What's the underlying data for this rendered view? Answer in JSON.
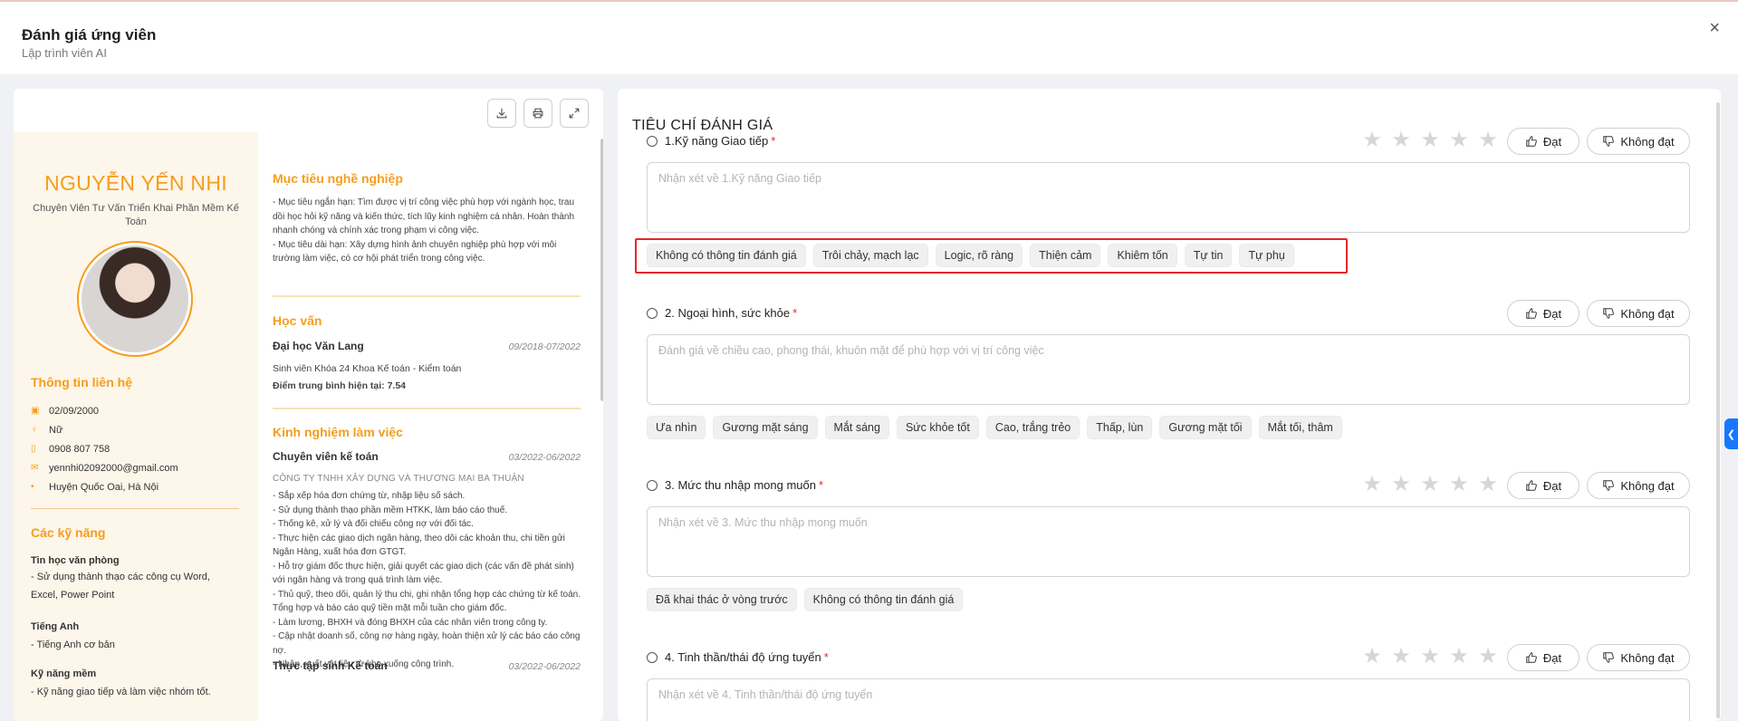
{
  "header": {
    "title": "Đánh giá ứng viên",
    "subtitle": "Lập trình viên AI",
    "close_icon": "×"
  },
  "cv": {
    "name": "NGUYỄN YẾN NHI",
    "position": "Chuyên Viên Tư Vấn Triển Khai Phần Mềm Kế Toán",
    "contact_title": "Thông tin liên hệ",
    "contact": {
      "dob": "02/09/2000",
      "gender": "Nữ",
      "phone": "0908 807 758",
      "email": "yennhi02092000@gmail.com",
      "address": "Huyện Quốc Oai, Hà Nội"
    },
    "skills_title": "Các kỹ năng",
    "skills": [
      {
        "title": "Tin học văn phòng",
        "desc": "- Sử dụng thành thạo các công cụ Word, Excel, Power Point"
      },
      {
        "title": "Tiếng Anh",
        "desc": "- Tiếng Anh cơ bản"
      },
      {
        "title": "Kỹ năng mềm",
        "desc": "- Kỹ năng giao tiếp và làm việc nhóm tốt."
      }
    ],
    "objective_title": "Mục tiêu nghề nghiệp",
    "objective_text": "- Mục tiêu ngắn hạn: Tìm được vị trí công việc phù hợp với ngành học, trau dồi học hỏi kỹ năng và kiến thức, tích lũy kinh nghiệm cá nhân. Hoàn thành nhanh chóng và chính xác trong phạm vi công việc.\n - Mục tiêu dài hạn: Xây dựng hình ảnh chuyên nghiệp phù hợp với môi trường làm việc, có cơ hội phát triển trong công việc.",
    "education_title": "Học vấn",
    "education": {
      "school": "Đại học Văn Lang",
      "period": "09/2018-07/2022",
      "detail": "Sinh viên Khóa 24 Khoa Kế toán - Kiểm toán",
      "gpa_label": "Điểm trung bình hiện tại: 7.54"
    },
    "experience_title": "Kinh nghiệm làm việc",
    "experience": [
      {
        "role": "Chuyên viên kế toán",
        "period": "03/2022-06/2022",
        "company": "CÔNG TY TNHH XÂY DỰNG VÀ THƯƠNG MẠI BA THUẬN",
        "desc": "- Sắp xếp hóa đơn chứng từ, nhập liệu số sách.\n - Sử dụng thành thạo phần mềm HTKK, làm báo cáo thuế.\n - Thống kê, xử lý và đối chiếu công nợ với đối tác.\n - Thực hiện các giao dịch ngân hàng, theo dõi các khoản thu, chi tiền gửi Ngân Hàng, xuất hóa đơn GTGT.\n - Hỗ trợ giám đốc thực hiện, giải quyết các giao dịch (các vấn đề phát sinh) với ngân hàng và trong quá trình làm việc.\n - Thủ quỹ, theo dõi, quản lý thu chi, ghi nhận tổng hợp các chứng từ kế toán. Tổng hợp và báo cáo quỹ tiền mặt mỗi tuần cho giám đốc.\n - Làm lương, BHXH và đóng BHXH của các nhân viên trong công ty.\n - Cập nhật doanh số, công nợ hàng ngày, hoàn thiện xử lý các báo cáo công nợ.\n - Nhập, xuất vật liệu từ kho xuống công trình."
      },
      {
        "role": "Thực tập sinh Kế toán",
        "period": "03/2022-06/2022"
      }
    ]
  },
  "evaluation": {
    "title": "TIÊU CHÍ ĐÁNH GIÁ",
    "pass_label": "Đạt",
    "fail_label": "Không đạt",
    "criteria": [
      {
        "label": "1.Kỹ năng Giao tiếp",
        "required": "*",
        "placeholder": "Nhận xét về 1.Kỹ năng Giao tiếp",
        "tags": [
          "Không có thông tin đánh giá",
          "Trôi chảy, mạch lạc",
          "Logic, rõ ràng",
          "Thiện cảm",
          "Khiêm tốn",
          "Tự tin",
          "Tự phụ"
        ]
      },
      {
        "label": "2. Ngoại hình, sức khỏe",
        "required": "*",
        "placeholder": "Đánh giá về chiều cao, phong thái, khuôn mặt để phù hợp với vị trí công việc",
        "tags": [
          "Ưa nhìn",
          "Gương mặt sáng",
          "Mắt sáng",
          "Sức khỏe tốt",
          "Cao, trắng trẻo",
          "Thấp, lùn",
          "Gương mặt tối",
          "Mắt tối, thâm"
        ]
      },
      {
        "label": "3. Mức thu nhập mong muốn",
        "required": "*",
        "placeholder": "Nhận xét về 3. Mức thu nhập mong muốn",
        "tags": [
          "Đã khai thác ở vòng trước",
          "Không có thông tin đánh giá"
        ]
      },
      {
        "label": "4. Tinh thần/thái độ ứng tuyển",
        "required": "*",
        "placeholder": "Nhận xét về 4. Tinh thần/thái độ ứng tuyển",
        "tags": []
      }
    ]
  },
  "colors": {
    "accent": "#f59d1c",
    "highlight": "#e5262b",
    "side_tab": "#1677ff"
  }
}
